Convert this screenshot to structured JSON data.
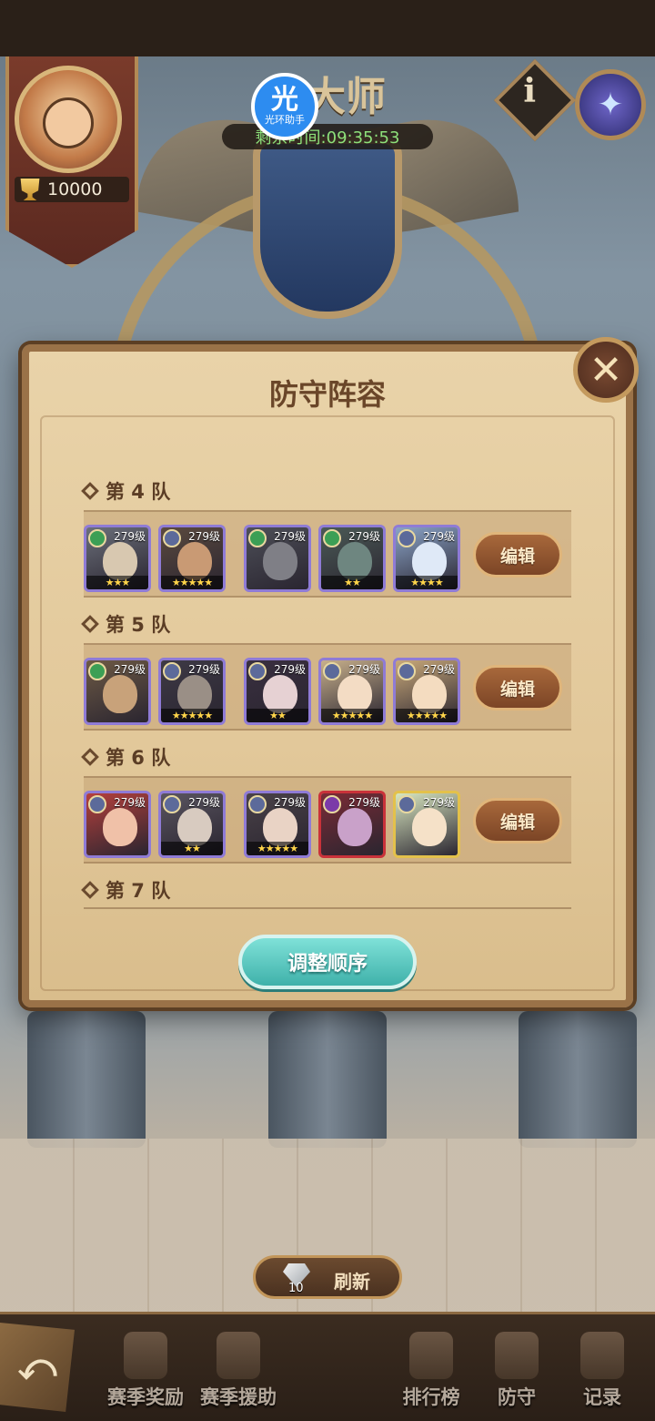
{
  "header": {
    "title": "大师",
    "timer": "剩余时间:09:35:53",
    "score": "10000",
    "overlay_logo": {
      "char": "光",
      "text": "光环助手"
    },
    "info_label": "i"
  },
  "modal": {
    "title": "防守阵容",
    "close_label": "✕",
    "edit_label": "编辑",
    "adjust_order_label": "调整顺序",
    "teams": [
      {
        "label": "第 4 队",
        "heroes": [
          {
            "level": "279级",
            "stars": "★★★",
            "frame": "purple",
            "faction": "green"
          },
          {
            "level": "279级",
            "stars": "★★★★★",
            "frame": "purple",
            "faction": "silver"
          },
          {
            "level": "279级",
            "stars": "",
            "frame": "purple",
            "faction": "green"
          },
          {
            "level": "279级",
            "stars": "★★",
            "frame": "purple",
            "faction": "green"
          },
          {
            "level": "279级",
            "stars": "★★★★",
            "frame": "purple",
            "faction": "silver"
          }
        ]
      },
      {
        "label": "第 5 队",
        "heroes": [
          {
            "level": "279级",
            "stars": "",
            "frame": "purple",
            "faction": "green"
          },
          {
            "level": "279级",
            "stars": "★★★★★",
            "frame": "purple",
            "faction": "silver"
          },
          {
            "level": "279级",
            "stars": "★★",
            "frame": "purple",
            "faction": "silver"
          },
          {
            "level": "279级",
            "stars": "★★★★★",
            "frame": "purple",
            "faction": "silver"
          },
          {
            "level": "279级",
            "stars": "★★★★★",
            "frame": "purple",
            "faction": "silver"
          }
        ]
      },
      {
        "label": "第 6 队",
        "heroes": [
          {
            "level": "279级",
            "stars": "",
            "frame": "purple",
            "faction": "silver"
          },
          {
            "level": "279级",
            "stars": "★★",
            "frame": "purple",
            "faction": "silver"
          },
          {
            "level": "279级",
            "stars": "★★★★★",
            "frame": "purple",
            "faction": "silver"
          },
          {
            "level": "279级",
            "stars": "",
            "frame": "red",
            "faction": "purple"
          },
          {
            "level": "279级",
            "stars": "",
            "frame": "gold",
            "faction": "silver"
          }
        ]
      }
    ],
    "partial_team_label": "第 7 队"
  },
  "refresh": {
    "label": "刷新",
    "cost": "10"
  },
  "nav": {
    "back_label": "⤺",
    "items": [
      "赛季奖励",
      "赛季援助",
      "排行榜",
      "防守",
      "记录"
    ]
  },
  "colors": {
    "frame_purple": "#8f7bd6",
    "frame_red": "#c9323a",
    "frame_gold": "#e3c14b",
    "faction_green": "#3c9f55",
    "faction_silver": "#5c6a9a",
    "faction_purple": "#7b3aa8",
    "accent_teal": "#4fc3bb",
    "edit_brown": "#8a4f2c"
  }
}
